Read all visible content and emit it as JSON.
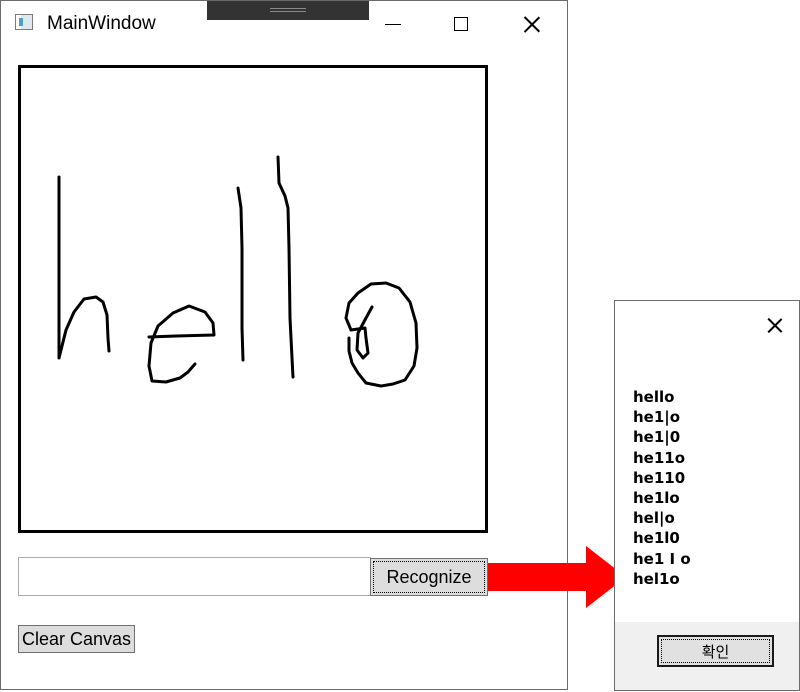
{
  "main_window": {
    "title": "MainWindow",
    "icons": {
      "app": "app-window-icon",
      "minimize": "minimize-icon",
      "maximize": "maximize-icon",
      "close": "close-icon"
    },
    "ink_canvas": {
      "handwritten_text": "hello",
      "stroke_color": "#000000"
    },
    "result_textbox": {
      "value": ""
    },
    "recognize_label": "Recognize",
    "clear_canvas_label": "Clear Canvas"
  },
  "arrow": {
    "color": "#ff0000"
  },
  "message_box": {
    "close_icon": "close-icon",
    "lines": [
      "hello",
      "he1|o",
      "he1|0",
      "he11o",
      "he110",
      "he1lo",
      "hel|o",
      "he1l0",
      "he1 I o",
      "hel1o"
    ],
    "ok_label": "확인"
  }
}
